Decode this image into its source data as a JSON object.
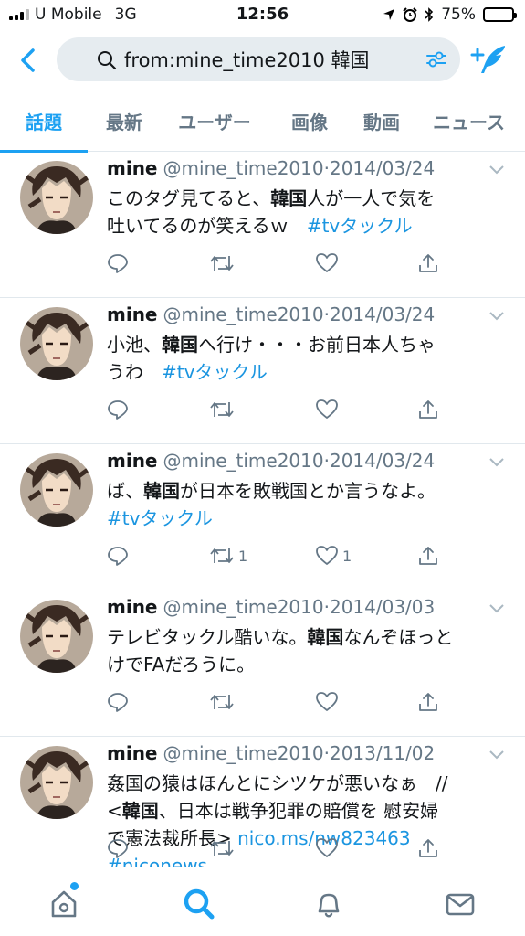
{
  "status_bar": {
    "carrier": "U Mobile",
    "network": "3G",
    "time": "12:56",
    "battery": "75%",
    "battery_level": 0.75,
    "icons": [
      "location-icon",
      "alarm-icon",
      "bluetooth-icon"
    ]
  },
  "search": {
    "query": "from:mine_time2010 韓国"
  },
  "tabs": [
    {
      "label": "話題",
      "active": true
    },
    {
      "label": "最新"
    },
    {
      "label": "ユーザー"
    },
    {
      "label": "画像"
    },
    {
      "label": "動画"
    },
    {
      "label": "ニュース"
    }
  ],
  "tweets": [
    {
      "name": "mine",
      "handle": "@mine_time2010",
      "sep": "·",
      "date": "2014/03/24",
      "lines": [
        [
          {
            "t": "このタグ見てると、"
          },
          {
            "t": "韓国",
            "b": true
          },
          {
            "t": "人が一人で気を"
          }
        ],
        [
          {
            "t": "吐いてるのが笑えるｗ　"
          },
          {
            "t": "#tvタックル",
            "tag": true
          }
        ]
      ],
      "retweets": "",
      "likes": ""
    },
    {
      "name": "mine",
      "handle": "@mine_time2010",
      "sep": "·",
      "date": "2014/03/24",
      "lines": [
        [
          {
            "t": "小池、"
          },
          {
            "t": "韓国",
            "b": true
          },
          {
            "t": "へ行け・・・お前日本人ちゃ"
          }
        ],
        [
          {
            "t": "うわ　"
          },
          {
            "t": "#tvタックル",
            "tag": true
          }
        ]
      ],
      "retweets": "",
      "likes": ""
    },
    {
      "name": "mine",
      "handle": "@mine_time2010",
      "sep": "·",
      "date": "2014/03/24",
      "lines": [
        [
          {
            "t": "ば、"
          },
          {
            "t": "韓国",
            "b": true
          },
          {
            "t": "が日本を敗戦国とか言うなよ。"
          }
        ],
        [
          {
            "t": "#tvタックル",
            "tag": true
          }
        ]
      ],
      "retweets": "1",
      "likes": "1"
    },
    {
      "name": "mine",
      "handle": "@mine_time2010",
      "sep": "·",
      "date": "2014/03/03",
      "lines": [
        [
          {
            "t": "テレビタックル酷いな。"
          },
          {
            "t": "韓国",
            "b": true
          },
          {
            "t": "なんぞほっと"
          }
        ],
        [
          {
            "t": "けでFAだろうに。"
          }
        ]
      ],
      "retweets": "",
      "likes": ""
    },
    {
      "name": "mine",
      "handle": "@mine_time2010",
      "sep": "·",
      "date": "2013/11/02",
      "lines": [
        [
          {
            "t": "姦国の猿はほんとにシツケが悪いなぁ　//"
          }
        ],
        [
          {
            "t": "<"
          },
          {
            "t": "韓国",
            "b": true
          },
          {
            "t": "、日本は戦争犯罪の賠償を 慰安婦"
          }
        ],
        [
          {
            "t": "で憲法裁所長> "
          },
          {
            "t": "nico.ms/nw823463",
            "link": true
          }
        ],
        [
          {
            "t": "#niconews",
            "tag": true
          }
        ]
      ],
      "retweets": "",
      "likes": ""
    }
  ],
  "bottom_nav": [
    {
      "name": "home-icon",
      "active": false,
      "dot": true
    },
    {
      "name": "search-icon",
      "active": true
    },
    {
      "name": "notifications-icon",
      "active": false
    },
    {
      "name": "messages-icon",
      "active": false
    }
  ],
  "colors": {
    "accent": "#1da1f2",
    "link": "#1b95e0",
    "muted": "#657786",
    "divider": "#e1e8ed",
    "search_bg": "#e6ecf0"
  }
}
